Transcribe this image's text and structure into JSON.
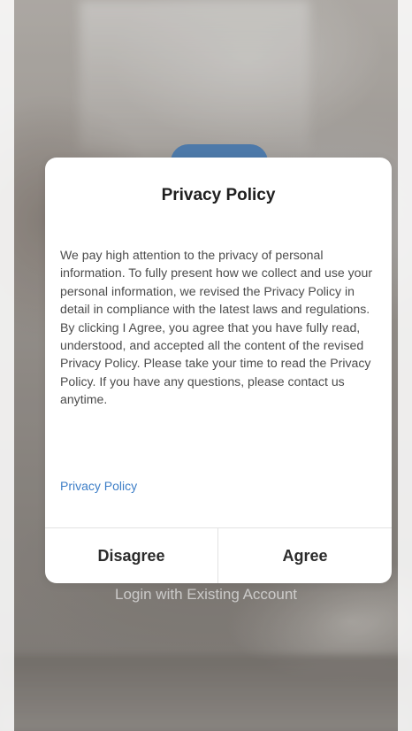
{
  "dialog": {
    "title": "Privacy Policy",
    "body": "We pay high attention to the privacy of personal information. To fully present how we collect and use your personal information, we revised the Privacy Policy in detail in compliance with the latest laws and regulations. By clicking I Agree, you agree that you have fully read, understood, and accepted all the content of the revised Privacy Policy. Please take your time to read the Privacy Policy. If you have any questions, please contact us anytime.",
    "link_label": "Privacy Policy",
    "disagree_label": "Disagree",
    "agree_label": "Agree"
  },
  "background": {
    "login_existing_label": "Login with Existing Account"
  },
  "colors": {
    "link": "#3d7ec7",
    "dialog_background": "#ffffff",
    "button_text": "#2b2b2b"
  }
}
